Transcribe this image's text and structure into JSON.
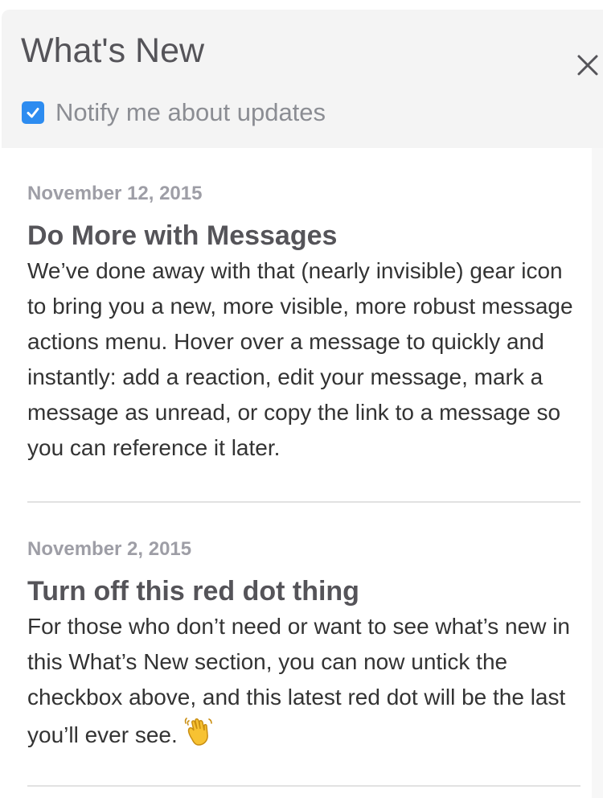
{
  "header": {
    "title": "What's New",
    "notify_label": "Notify me about updates",
    "notify_checked": true
  },
  "entries": [
    {
      "date": "November 12, 2015",
      "title": "Do More with Messages",
      "body": "We’ve done away with that (nearly invisible) gear icon to bring you a new, more visible, more robust message actions menu. Hover over a message to quickly and instantly: add a reaction, edit your message, mark a message as unread, or copy the link to a message so you can reference it later."
    },
    {
      "date": "November 2, 2015",
      "title": "Turn off this red dot thing",
      "body": "For those who don’t need or want to see what’s new in this What’s New section, you can now untick the checkbox above, and this latest red dot will be the last you’ll ever see.",
      "emoji_icon": "waving-hand-icon"
    }
  ],
  "colors": {
    "header_bg": "#f4f4f4",
    "checkbox_blue": "#2d8cf0",
    "title_text": "#555459",
    "date_text": "#9e9ea6",
    "body_text": "#333333",
    "divider": "#e2e2e2"
  }
}
